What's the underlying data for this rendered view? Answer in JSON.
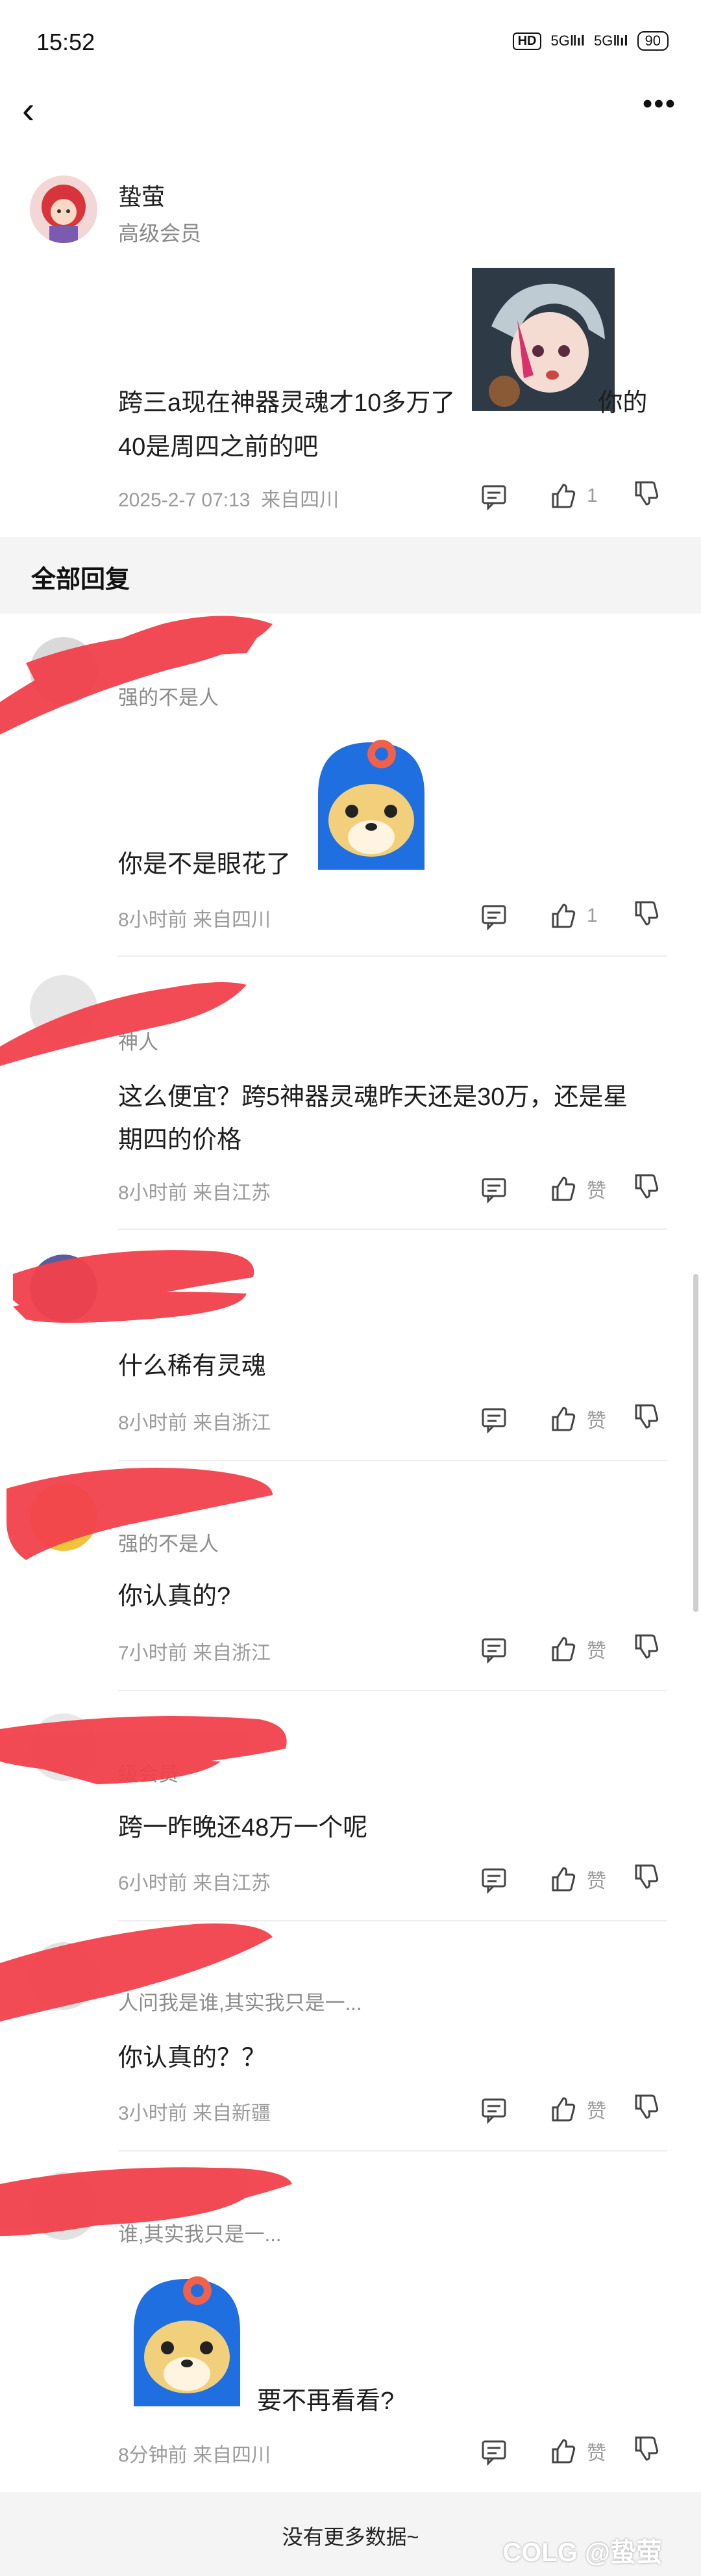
{
  "status_bar": {
    "time": "15:52",
    "hd": "HD",
    "signal_1": "5G",
    "signal_2": "5G",
    "battery": "90"
  },
  "nav": {
    "back_icon": "chevron-left-icon",
    "more_icon": "more-dots-icon",
    "back_glyph": "‹",
    "more_glyph": "•••"
  },
  "post": {
    "author_name": "蛰萤",
    "author_level": "高级会员",
    "text_line1_a": "跨三a现在神器灵魂才10多万了",
    "text_line1_b": "你的",
    "text_line2": "40是周四之前的吧",
    "time": "2025-2-7 07:13",
    "location": "来自四川",
    "likes": "1"
  },
  "section_title": "全部回复",
  "replies": [
    {
      "level": "强的不是人",
      "text_lines": [
        "你是不是眼花了"
      ],
      "time": "8小时前",
      "location": "来自四川",
      "likes": "1"
    },
    {
      "level": "神人",
      "text_lines": [
        "这么便宜？跨5神器灵魂昨天还是30万，还是星",
        "期四的价格"
      ],
      "time": "8小时前",
      "location": "来自江苏",
      "likes": "赞"
    },
    {
      "level": "",
      "text_lines": [
        "什么稀有灵魂"
      ],
      "time": "8小时前",
      "location": "来自浙江",
      "likes": "赞"
    },
    {
      "level": "强的不是人",
      "text_lines": [
        "你认真的?"
      ],
      "time": "7小时前",
      "location": "来自浙江",
      "likes": "赞"
    },
    {
      "level": "级会员",
      "text_lines": [
        "跨一昨晚还48万一个呢"
      ],
      "time": "6小时前",
      "location": "来自江苏",
      "likes": "赞"
    },
    {
      "level": "人问我是谁,其实我只是一...",
      "text_lines": [
        "你认真的？？"
      ],
      "time": "3小时前",
      "location": "来自新疆",
      "likes": "赞"
    },
    {
      "level": "谁,其实我只是一...",
      "text_lines": [
        "要不再看看?"
      ],
      "time": "8分钟前",
      "location": "来自四川",
      "likes": "赞"
    }
  ],
  "footer": {
    "text": "没有更多数据~",
    "watermark": "COLG @蛰萤"
  },
  "colors": {
    "redact": "#f2414c",
    "section_bg": "#f4f4f4",
    "meta": "#9b9b9b",
    "sticker_blue": "#1f6fe0"
  }
}
